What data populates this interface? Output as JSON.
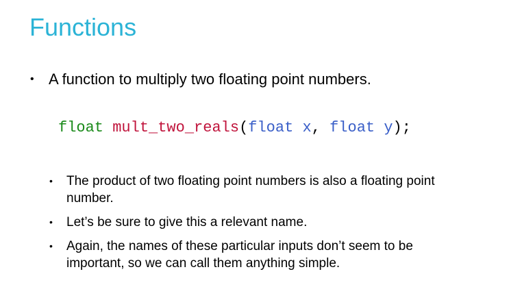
{
  "slide": {
    "title": "Functions",
    "bullet": "A function to multiply two floating point numbers.",
    "bullet_marker": "•",
    "code": {
      "ret_type": "float",
      "space1": " ",
      "func_name": "mult_two_reals",
      "open_paren": "(",
      "param1_type": "float",
      "param1_space": " ",
      "param1_name": "x",
      "comma": ", ",
      "param2_type": "float",
      "param2_space": " ",
      "param2_name": "y",
      "close": ");"
    },
    "sub_bullets": [
      "The product of two floating point numbers is also a floating point number.",
      "Let’s be sure to give this a relevant name.",
      "Again, the names of these particular inputs don’t seem to be important, so we can call them anything simple."
    ]
  }
}
